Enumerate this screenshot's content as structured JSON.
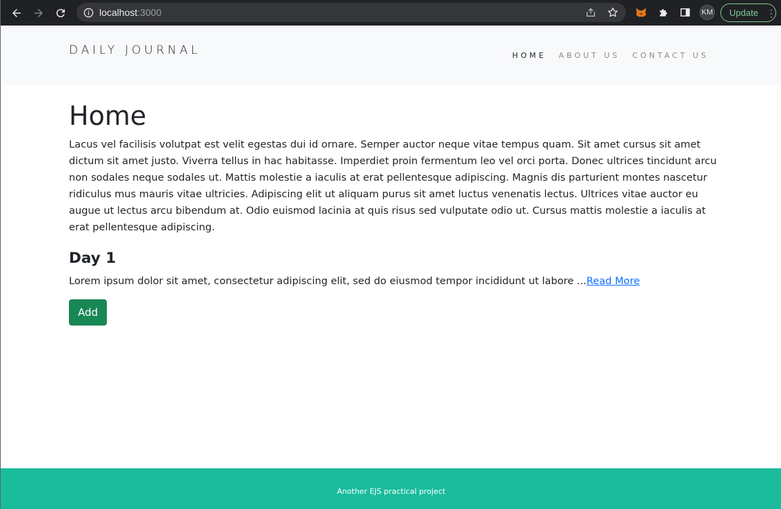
{
  "browser": {
    "url_host": "localhost",
    "url_port": ":3000",
    "profile_initials": "KM",
    "update_label": "Update",
    "menu_glyph": "⋮",
    "accent_color": "#81c995"
  },
  "header": {
    "brand": "DAILY JOURNAL",
    "nav": [
      {
        "label": "HOME",
        "active": true
      },
      {
        "label": "ABOUT US",
        "active": false
      },
      {
        "label": "CONTACT US",
        "active": false
      }
    ]
  },
  "main": {
    "title": "Home",
    "intro": "Lacus vel facilisis volutpat est velit egestas dui id ornare. Semper auctor neque vitae tempus quam. Sit amet cursus sit amet dictum sit amet justo. Viverra tellus in hac habitasse. Imperdiet proin fermentum leo vel orci porta. Donec ultrices tincidunt arcu non sodales neque sodales ut. Mattis molestie a iaculis at erat pellentesque adipiscing. Magnis dis parturient montes nascetur ridiculus mus mauris vitae ultricies. Adipiscing elit ut aliquam purus sit amet luctus venenatis lectus. Ultrices vitae auctor eu augue ut lectus arcu bibendum at. Odio euismod lacinia at quis risus sed vulputate odio ut. Cursus mattis molestie a iaculis at erat pellentesque adipiscing.",
    "posts": [
      {
        "title": "Day 1",
        "excerpt": "Lorem ipsum dolor sit amet, consectetur adipiscing elit, sed do eiusmod tempor incididunt ut labore ...",
        "read_more": "Read More"
      }
    ],
    "add_label": "Add",
    "add_color": "#198754"
  },
  "footer": {
    "text": "Another EJS practical project",
    "color": "#1abc9c"
  }
}
